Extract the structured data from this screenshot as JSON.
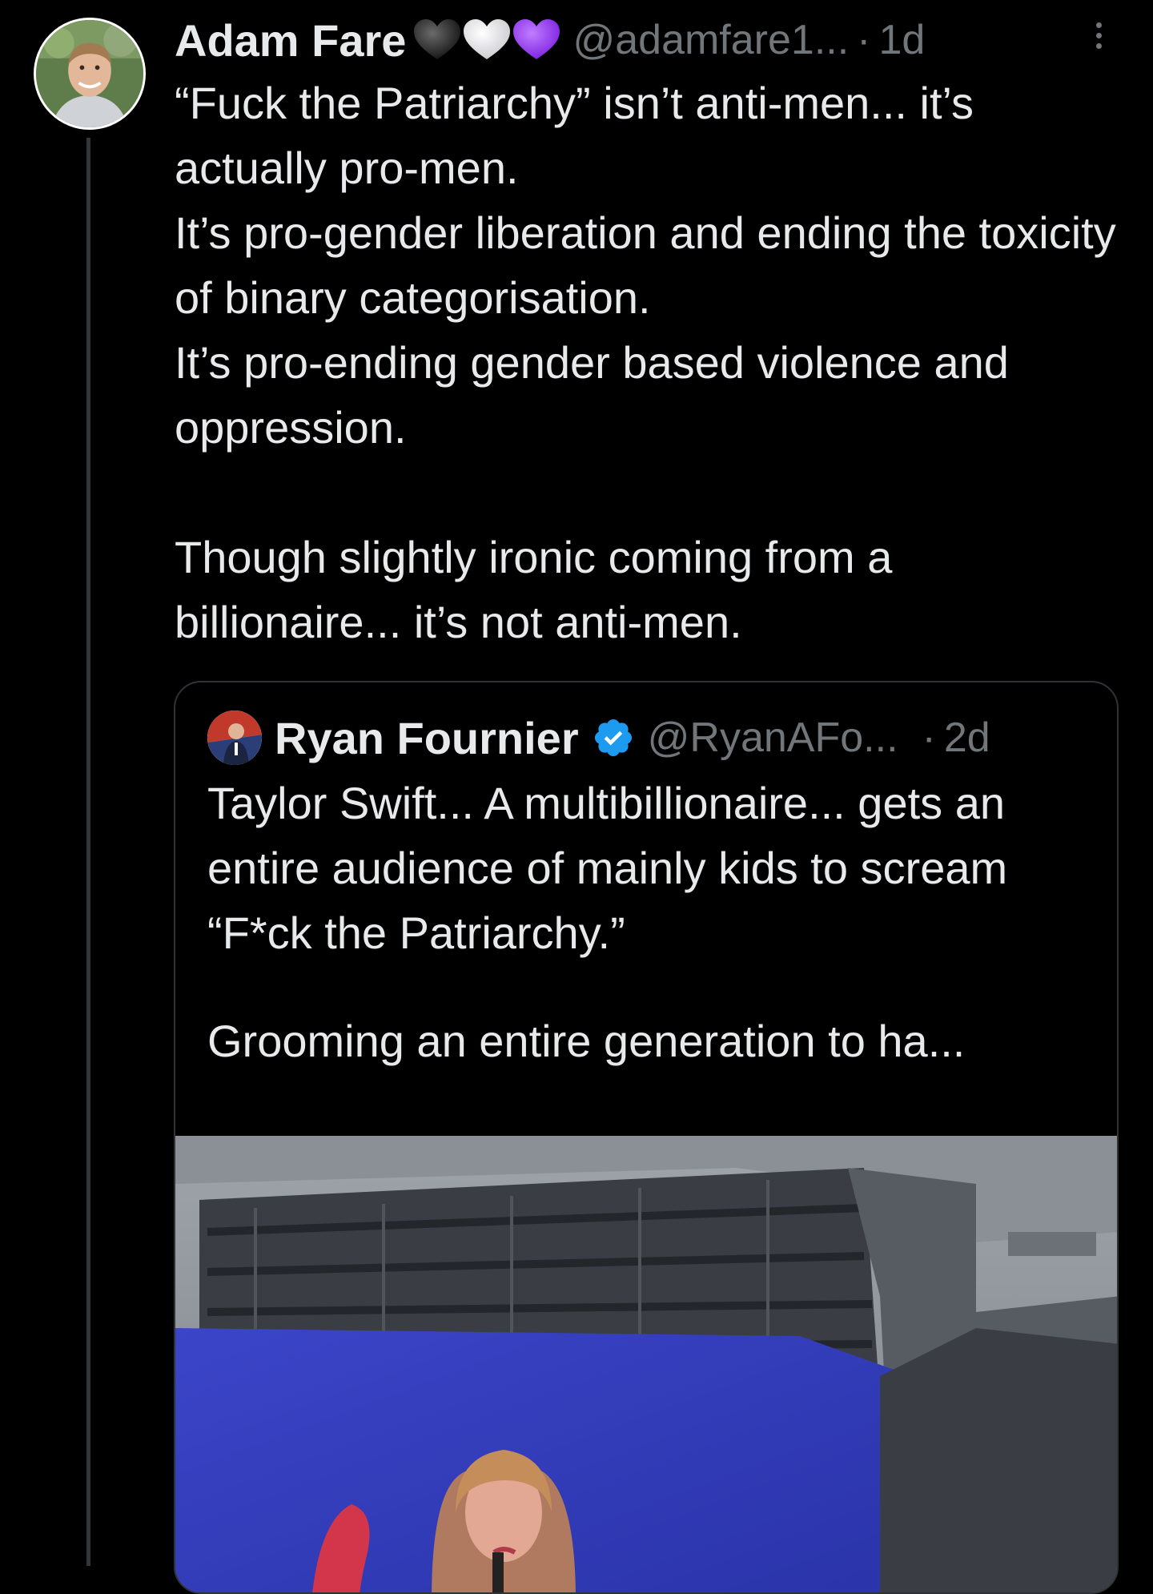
{
  "tweet": {
    "author": {
      "name": "Adam Fare",
      "handle": "@adamfare1...",
      "hearts": [
        "black-heart-icon",
        "white-heart-icon",
        "purple-heart-icon"
      ]
    },
    "separator": "·",
    "time": "1d",
    "text": [
      "“Fuck the Patriarchy” isn’t anti-men... it’s actually pro-men.",
      "It’s pro-gender liberation and ending the toxicity of binary categorisation.",
      "It’s pro-ending gender based violence and oppression.",
      "",
      "Though slightly ironic coming from a billionaire... it’s not anti-men."
    ]
  },
  "quote": {
    "author": {
      "name": "Ryan Fournier",
      "handle": "@RyanAFo...",
      "verified": true
    },
    "separator": "·",
    "time": "2d",
    "text": [
      "Taylor Swift... A multibillionaire... gets an entire audience of mainly kids to scream “F*ck the Patriarchy.”",
      "",
      "Grooming an entire generation to ha..."
    ]
  },
  "colors": {
    "background": "#000000",
    "text": "#e7e9ea",
    "secondary_text": "#71767b",
    "border": "#2f3336",
    "verified_blue": "#1d9bf0",
    "purple_heart": "#9b30ff"
  }
}
